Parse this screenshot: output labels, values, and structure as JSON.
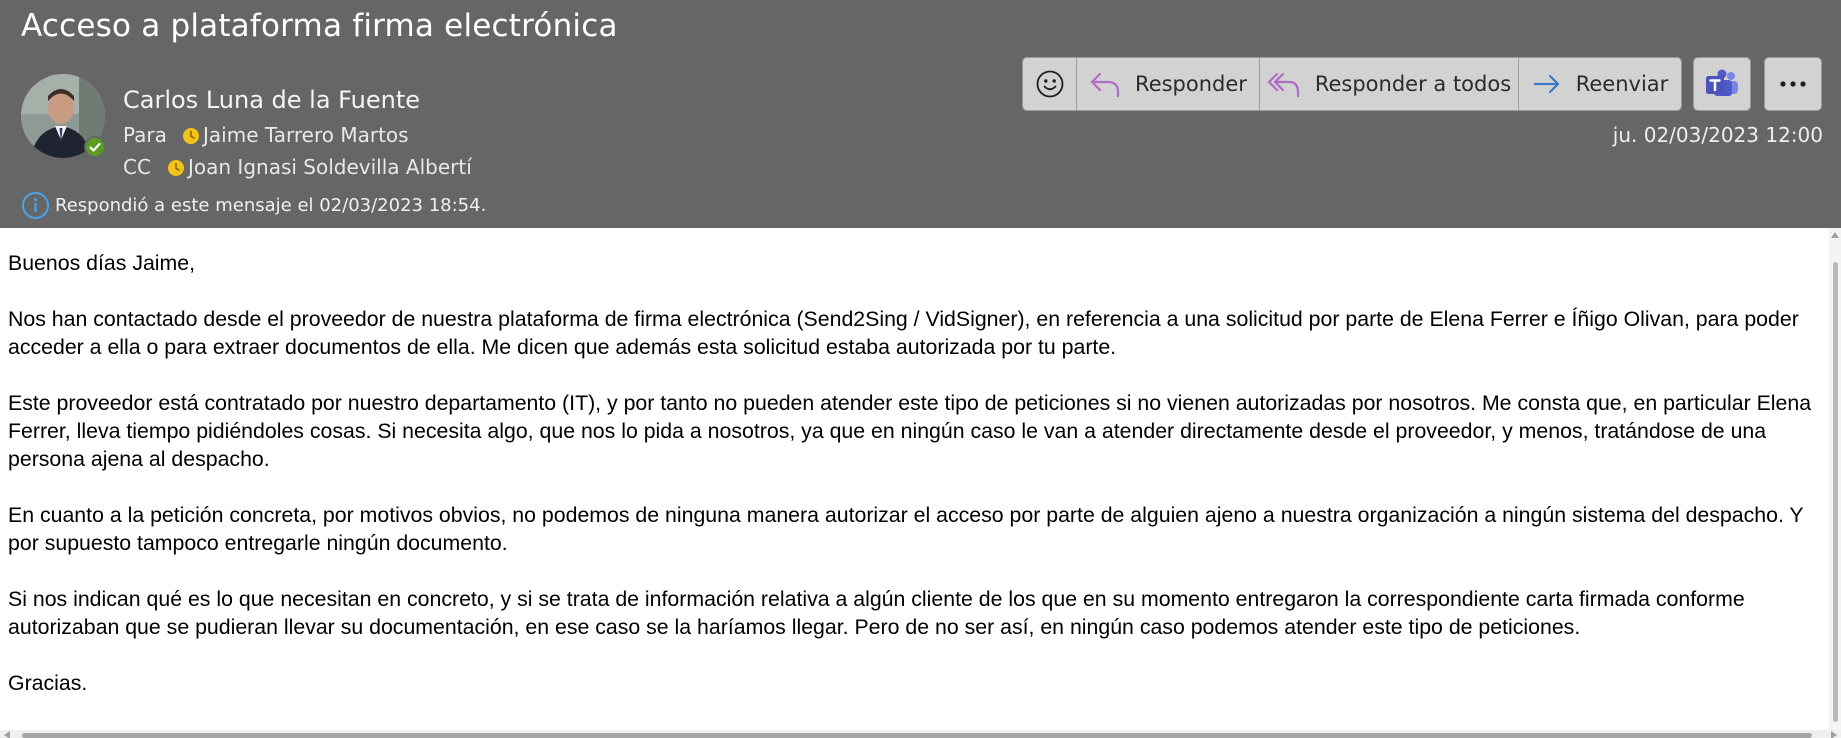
{
  "message": {
    "subject": "Acceso a plataforma firma electrónica",
    "sender": "Carlos Luna de la Fuente",
    "to_label": "Para",
    "to_name": "Jaime Tarrero Martos",
    "cc_label": "CC",
    "cc_name": "Joan Ignasi Soldevilla Albertí",
    "info": "Respondió a este mensaje el 02/03/2023 18:54.",
    "date": "ju. 02/03/2023 12:00",
    "sender_status": "available"
  },
  "actions": {
    "reply": "Responder",
    "reply_all": "Responder a todos",
    "forward": "Reenviar"
  },
  "icons": {
    "emoji": "smiley-icon",
    "reply": "reply-arrow-icon",
    "reply_all": "reply-all-arrow-icon",
    "forward": "forward-arrow-icon",
    "teams": "teams-icon",
    "more": "more-dots-icon",
    "info": "info-icon",
    "recipient_status": "clock-icon"
  },
  "colors": {
    "header_bg": "#666666",
    "reply_icon": "#b06bc6",
    "forward_icon": "#3a78c9",
    "teams": "#5059c9",
    "presence": "#5a9e21",
    "clock": "#f2c21b"
  },
  "body": {
    "greeting": "Buenos días Jaime,",
    "p1": "Nos han contactado desde el proveedor de nuestra plataforma de firma electrónica (Send2Sing / VidSigner), en referencia a una solicitud por parte de Elena Ferrer e Íñigo Olivan, para poder acceder a ella o para extraer documentos de ella. Me dicen que además esta solicitud estaba autorizada por tu parte.",
    "p2": "Este proveedor está contratado por nuestro departamento (IT), y por tanto no pueden atender este tipo de peticiones si no vienen autorizadas por nosotros. Me consta que, en particular Elena Ferrer, lleva tiempo pidiéndoles cosas. Si necesita algo, que nos lo pida a nosotros, ya que en ningún caso le van a atender directamente desde el proveedor, y menos, tratándose de una persona ajena al despacho.",
    "p3": "En cuanto a la petición concreta, por motivos obvios, no podemos de ninguna manera autorizar el acceso por parte de alguien ajeno a nuestra organización a ningún sistema del despacho. Y por supuesto tampoco entregarle ningún documento.",
    "p4": "Si nos indican qué es lo que necesitan en concreto, y si se trata de información relativa a algún cliente de los que en su momento entregaron la correspondiente carta firmada conforme autorizaban que se pudieran llevar su documentación, en ese caso se la haríamos llegar. Pero de no ser así, en ningún caso podemos atender este tipo de peticiones.",
    "closing": "Gracias."
  }
}
